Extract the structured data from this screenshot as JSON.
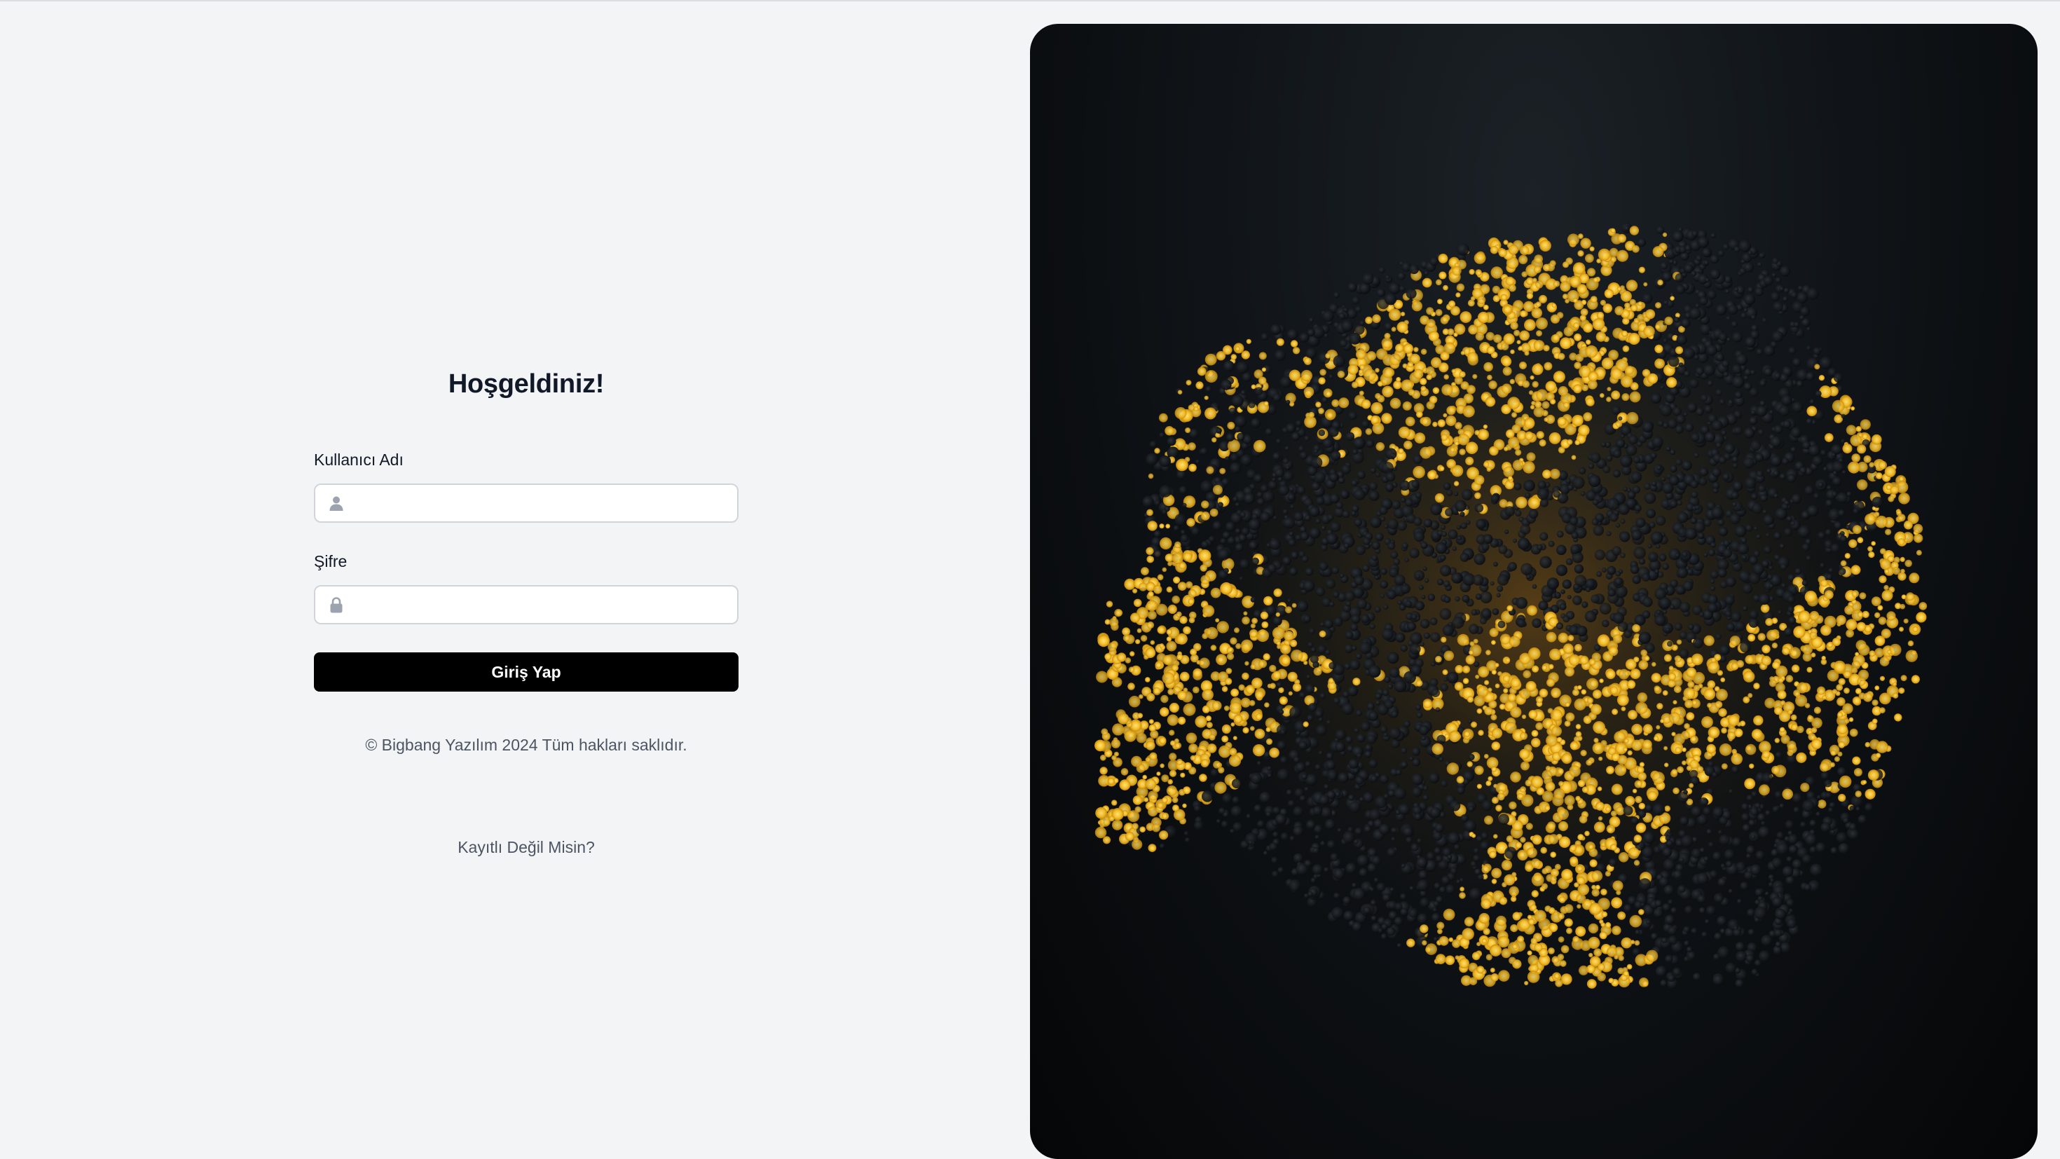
{
  "login": {
    "title": "Hoşgeldiniz!",
    "username_label": "Kullanıcı Adı",
    "username_value": "",
    "password_label": "Şifre",
    "password_value": "",
    "submit_label": "Giriş Yap",
    "copyright": "© Bigbang Yazılım 2024 Tüm hakları saklıdır.",
    "register_link": "Kayıtlı Değil Misin?"
  },
  "colors": {
    "background": "#f3f4f6",
    "button": "#000000",
    "accent_gold": "#f5c02a"
  },
  "icons": {
    "username": "user-icon",
    "password": "lock-icon"
  }
}
